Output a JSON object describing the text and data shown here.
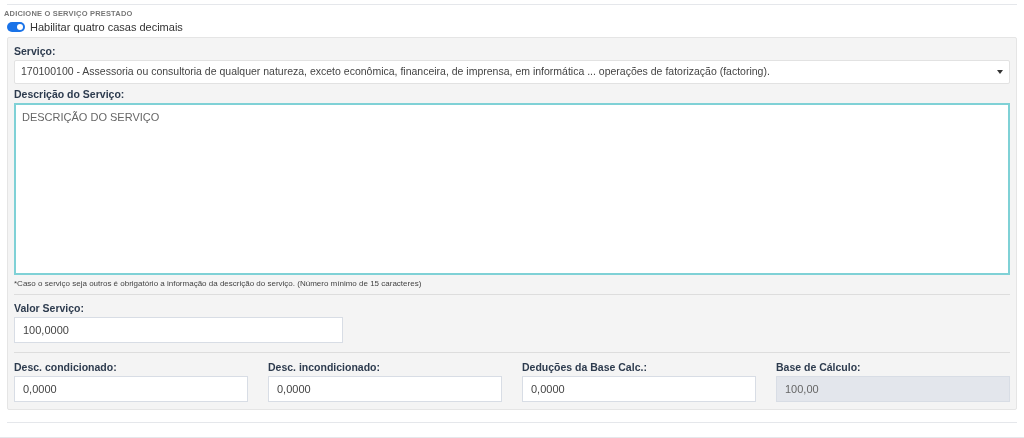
{
  "section": {
    "title": "ADICIONE O SERVIÇO PRESTADO"
  },
  "toggle": {
    "label": "Habilitar quatro casas decimais",
    "on": true
  },
  "service": {
    "label": "Serviço:",
    "value": "170100100 - Assessoria ou consultoria de qualquer natureza, exceto econômica, financeira, de imprensa, em informática ... operações de fatorização (factoring)."
  },
  "description": {
    "label": "Descrição do Serviço:",
    "placeholder": "DESCRIÇÃO DO SERVIÇO",
    "note": "*Caso o serviço seja outros é obrigatório a informação da descrição do serviço. (Número mínimo de 15 caracteres)"
  },
  "valor": {
    "label": "Valor Serviço:",
    "value": "100,0000"
  },
  "fields": [
    {
      "label": "Desc. condicionado:",
      "value": "0,0000",
      "disabled": false
    },
    {
      "label": "Desc. incondicionado:",
      "value": "0,0000",
      "disabled": false
    },
    {
      "label": "Deduções da Base Calc.:",
      "value": "0,0000",
      "disabled": false
    },
    {
      "label": "Base de Cálculo:",
      "value": "100,00",
      "disabled": true
    }
  ]
}
